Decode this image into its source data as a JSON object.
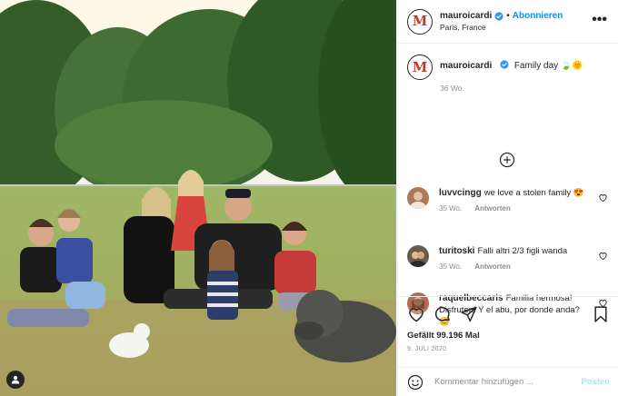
{
  "post": {
    "photo_alt": "",
    "header": {
      "avatar_letter": "M",
      "username": "mauroicardi",
      "dot": "•",
      "follow_label": "Abonnieren",
      "location": "Paris, France",
      "more_label": "•••"
    },
    "caption": {
      "username": "mauroicardi",
      "text": "Family day 🍃🌞",
      "age": "36 Wo."
    },
    "comments": [
      {
        "username": "luvvcingg",
        "text": "we love a stolen family 😍",
        "age": "35 Wo.",
        "reply_label": "Antworten",
        "avatar_color": "#a87a5a"
      },
      {
        "username": "turitoski",
        "text": "Falli altri 2/3 figli wanda",
        "age": "35 Wo.",
        "reply_label": "Antworten",
        "avatar_color": "#6b5a4a"
      },
      {
        "username": "raquelbeccaris",
        "text": "Familia hermosa! Disfruten! Y el abu, por donde anda? 😊",
        "age": "",
        "reply_label": "",
        "avatar_color": "#b56b4f"
      }
    ],
    "likes": "Gefällt 99.196 Mal",
    "date": "9. JULI 2020",
    "comment_input": {
      "placeholder": "Kommentar hinzufügen ...",
      "post_label": "Posten"
    },
    "icons": {
      "heart": "heart-icon",
      "comment": "comment-icon",
      "share": "share-icon",
      "save": "bookmark-icon",
      "emoji": "smiley-icon",
      "load_more": "plus-circle-icon",
      "verified": "verified-badge-icon",
      "user_tag": "user-tag-icon"
    },
    "colors": {
      "link_blue": "#0095f6",
      "muted": "#8e8e8e",
      "text": "#262626",
      "border": "#efefef"
    }
  }
}
